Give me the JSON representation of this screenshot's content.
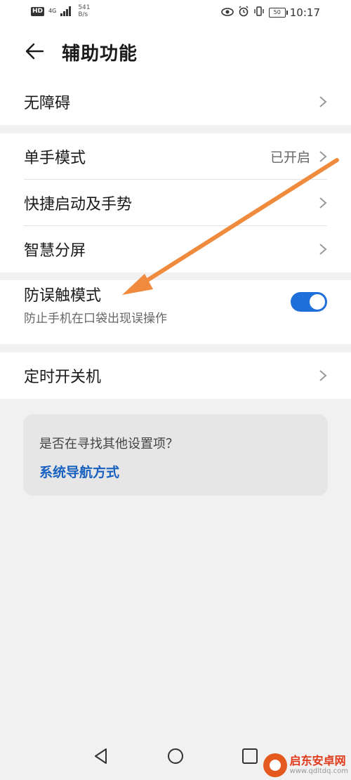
{
  "status_bar": {
    "hd": "HD",
    "net": "4G",
    "speed_value": "541",
    "speed_unit": "B/s",
    "battery": "50",
    "time": "10:17"
  },
  "header": {
    "title": "辅助功能"
  },
  "items": {
    "accessibility": "无障碍",
    "one_hand": {
      "label": "单手模式",
      "value": "已开启"
    },
    "quick_launch": "快捷启动及手势",
    "split_screen": "智慧分屏",
    "pocket_mode": {
      "label": "防误触模式",
      "subtitle": "防止手机在口袋出现误操作",
      "enabled": true
    },
    "scheduled_power": "定时开关机"
  },
  "suggestion": {
    "question": "是否在寻找其他设置项？",
    "link": "系统导航方式"
  },
  "colors": {
    "accent": "#1e6fd9",
    "link": "#1861c0",
    "annotation": "#f08a3c"
  },
  "watermark": {
    "name": "启东安卓网",
    "url": "www.qdltdq.com"
  }
}
